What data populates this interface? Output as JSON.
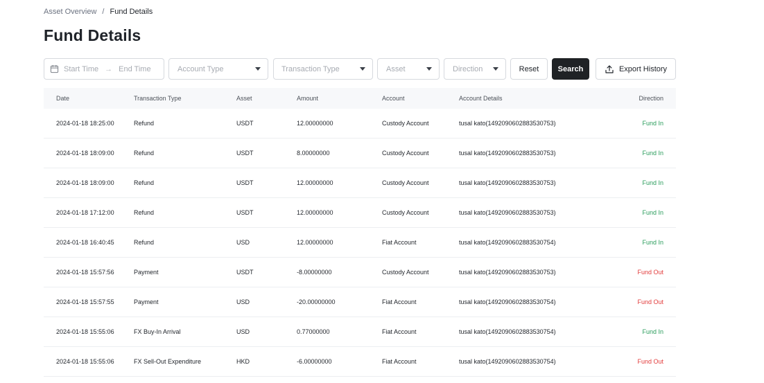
{
  "breadcrumb": {
    "parent": "Asset Overview",
    "separator": "/",
    "current": "Fund Details"
  },
  "page": {
    "title": "Fund Details"
  },
  "filters": {
    "start_placeholder": "Start Time",
    "end_placeholder": "End Time",
    "account_type": "Account Type",
    "transaction_type": "Transaction Type",
    "asset": "Asset",
    "direction": "Direction"
  },
  "buttons": {
    "reset": "Reset",
    "search": "Search",
    "export": "Export History"
  },
  "icons": {
    "calendar": "calendar-icon",
    "export": "upload-icon",
    "chevron": "chevron-down-icon",
    "arrow": "arrow-right-icon"
  },
  "colors": {
    "fund_in": "#2a9d5c",
    "fund_out": "#e23b3b",
    "primary_button": "#1f2225"
  },
  "table": {
    "columns": [
      "Date",
      "Transaction Type",
      "Asset",
      "Amount",
      "Account",
      "Account Details",
      "Direction"
    ],
    "rows": [
      {
        "date": "2024-01-18 18:25:00",
        "type": "Refund",
        "asset": "USDT",
        "amount": "12.00000000",
        "account": "Custody Account",
        "details": "tusal kato(1492090602883530753)",
        "direction": "Fund In"
      },
      {
        "date": "2024-01-18 18:09:00",
        "type": "Refund",
        "asset": "USDT",
        "amount": "8.00000000",
        "account": "Custody Account",
        "details": "tusal kato(1492090602883530753)",
        "direction": "Fund In"
      },
      {
        "date": "2024-01-18 18:09:00",
        "type": "Refund",
        "asset": "USDT",
        "amount": "12.00000000",
        "account": "Custody Account",
        "details": "tusal kato(1492090602883530753)",
        "direction": "Fund In"
      },
      {
        "date": "2024-01-18 17:12:00",
        "type": "Refund",
        "asset": "USDT",
        "amount": "12.00000000",
        "account": "Custody Account",
        "details": "tusal kato(1492090602883530753)",
        "direction": "Fund In"
      },
      {
        "date": "2024-01-18 16:40:45",
        "type": "Refund",
        "asset": "USD",
        "amount": "12.00000000",
        "account": "Fiat Account",
        "details": "tusal kato(1492090602883530754)",
        "direction": "Fund In"
      },
      {
        "date": "2024-01-18 15:57:56",
        "type": "Payment",
        "asset": "USDT",
        "amount": "-8.00000000",
        "account": "Custody Account",
        "details": "tusal kato(1492090602883530753)",
        "direction": "Fund Out"
      },
      {
        "date": "2024-01-18 15:57:55",
        "type": "Payment",
        "asset": "USD",
        "amount": "-20.00000000",
        "account": "Fiat Account",
        "details": "tusal kato(1492090602883530754)",
        "direction": "Fund Out"
      },
      {
        "date": "2024-01-18 15:55:06",
        "type": "FX Buy-In Arrival",
        "asset": "USD",
        "amount": "0.77000000",
        "account": "Fiat Account",
        "details": "tusal kato(1492090602883530754)",
        "direction": "Fund In"
      },
      {
        "date": "2024-01-18 15:55:06",
        "type": "FX Sell-Out Expenditure",
        "asset": "HKD",
        "amount": "-6.00000000",
        "account": "Fiat Account",
        "details": "tusal kato(1492090602883530754)",
        "direction": "Fund Out"
      }
    ]
  }
}
